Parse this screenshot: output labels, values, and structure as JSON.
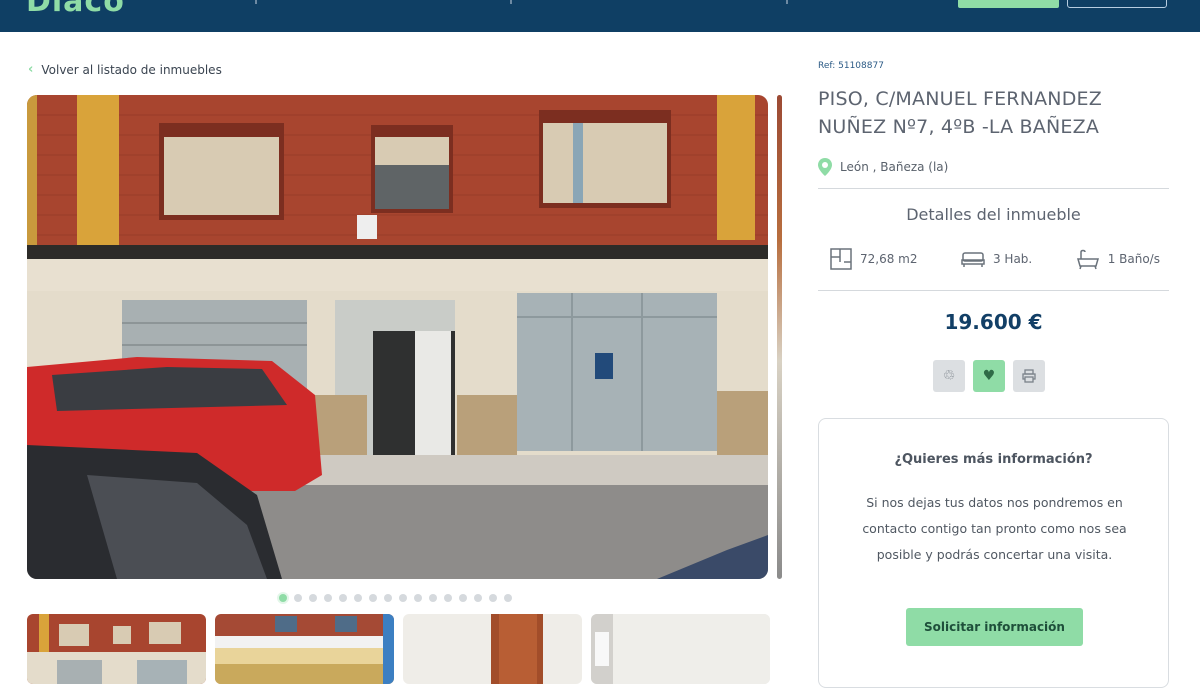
{
  "header": {
    "logo_text": "Diaco",
    "colors": {
      "bar": "#0f3f64",
      "accent": "#8fdca6"
    }
  },
  "back_link": {
    "label": "Volver al listado de inmuebles",
    "icon": "chevron-left-icon"
  },
  "gallery": {
    "main_photo": "building-facade-photo",
    "slide_count": 16,
    "active_slide": 1,
    "thumbnails": [
      "thumb-facade",
      "thumb-building-corner",
      "thumb-interior-door",
      "thumb-interior-room"
    ]
  },
  "property": {
    "ref": "Ref: 51108877",
    "title": "PISO, C/MANUEL FERNANDEZ NUÑEZ Nº7, 4ºB -LA BAÑEZA",
    "location": "León , Bañeza (la)",
    "details_heading": "Detalles del inmueble",
    "features": [
      {
        "icon": "floor-plan-icon",
        "label": "72,68 m2"
      },
      {
        "icon": "bed-icon",
        "label": "3 Hab."
      },
      {
        "icon": "bathtub-icon",
        "label": "1 Baño/s"
      }
    ],
    "price": "19.600 €"
  },
  "actions": [
    {
      "icon": "recycle-icon",
      "active": false
    },
    {
      "icon": "heart-icon",
      "active": true
    },
    {
      "icon": "print-icon",
      "active": false
    }
  ],
  "contact_card": {
    "heading": "¿Quieres más información?",
    "text": "Si nos dejas tus datos nos pondremos en contacto contigo tan pronto como nos sea posible y podrás concertar una visita.",
    "button": "Solicitar información"
  }
}
